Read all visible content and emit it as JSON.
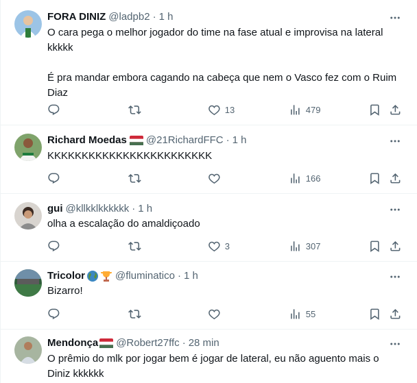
{
  "tweets": [
    {
      "name": "FORA DINIZ",
      "handle": "@ladpb2",
      "time": "1 h",
      "text": "O cara pega o melhor jogador do time na fase atual e improvisa na lateral kkkkk\n\nÉ pra mandar embora cagando na cabeça que nem o Vasco fez com o Ruim Diaz",
      "likes": "13",
      "views": "479"
    },
    {
      "name": "Richard Moedas",
      "handle": "@21RichardFFC",
      "time": "1 h",
      "text": "KKKKKKKKKKKKKKKKKKKKKKKK",
      "likes": "",
      "views": "166"
    },
    {
      "name": "gui",
      "handle": "@kllkklkkkkkk",
      "time": "1 h",
      "text": "olha a escalação do amaldiçoado",
      "likes": "3",
      "views": "307"
    },
    {
      "name": "Tricolor",
      "handle": "@fluminatico",
      "time": "1 h",
      "text": "Bizarro!",
      "likes": "",
      "views": "55"
    },
    {
      "name": "Mendonça",
      "handle": "@Robert27ffc",
      "time": "28 min",
      "text": "O prêmio do mlk por jogar bem é jogar de lateral, eu não aguento mais o Diniz kkkkkk",
      "likes": "",
      "views": ""
    }
  ],
  "separator": "·",
  "icons": {
    "reply": "reply-icon",
    "retweet": "retweet-icon",
    "like": "heart-icon",
    "views": "views-chart-icon",
    "bookmark": "bookmark-icon",
    "share": "share-icon",
    "more": "more-dots-icon",
    "flag": "hungary-flag-icon",
    "globe": "globe-emoji-icon",
    "trophy": "trophy-emoji-icon"
  },
  "colors": {
    "text": "#0f1419",
    "secondary": "#536471",
    "divider": "#eff3f4",
    "flag_red": "#ce2939",
    "flag_white": "#ffffff",
    "flag_green": "#477050"
  }
}
